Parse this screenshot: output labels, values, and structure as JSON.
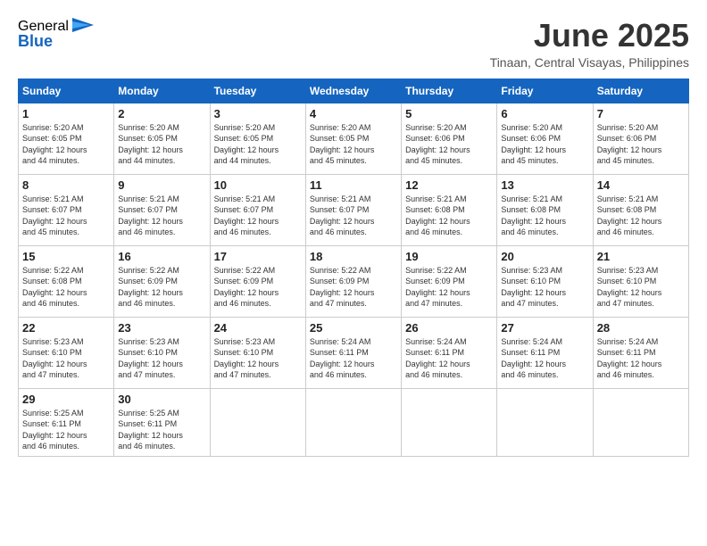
{
  "logo": {
    "general": "General",
    "blue": "Blue"
  },
  "title": "June 2025",
  "location": "Tinaan, Central Visayas, Philippines",
  "days_header": [
    "Sunday",
    "Monday",
    "Tuesday",
    "Wednesday",
    "Thursday",
    "Friday",
    "Saturday"
  ],
  "weeks": [
    [
      {
        "day": "1",
        "info": "Sunrise: 5:20 AM\nSunset: 6:05 PM\nDaylight: 12 hours\nand 44 minutes."
      },
      {
        "day": "2",
        "info": "Sunrise: 5:20 AM\nSunset: 6:05 PM\nDaylight: 12 hours\nand 44 minutes."
      },
      {
        "day": "3",
        "info": "Sunrise: 5:20 AM\nSunset: 6:05 PM\nDaylight: 12 hours\nand 44 minutes."
      },
      {
        "day": "4",
        "info": "Sunrise: 5:20 AM\nSunset: 6:05 PM\nDaylight: 12 hours\nand 45 minutes."
      },
      {
        "day": "5",
        "info": "Sunrise: 5:20 AM\nSunset: 6:06 PM\nDaylight: 12 hours\nand 45 minutes."
      },
      {
        "day": "6",
        "info": "Sunrise: 5:20 AM\nSunset: 6:06 PM\nDaylight: 12 hours\nand 45 minutes."
      },
      {
        "day": "7",
        "info": "Sunrise: 5:20 AM\nSunset: 6:06 PM\nDaylight: 12 hours\nand 45 minutes."
      }
    ],
    [
      {
        "day": "8",
        "info": "Sunrise: 5:21 AM\nSunset: 6:07 PM\nDaylight: 12 hours\nand 45 minutes."
      },
      {
        "day": "9",
        "info": "Sunrise: 5:21 AM\nSunset: 6:07 PM\nDaylight: 12 hours\nand 46 minutes."
      },
      {
        "day": "10",
        "info": "Sunrise: 5:21 AM\nSunset: 6:07 PM\nDaylight: 12 hours\nand 46 minutes."
      },
      {
        "day": "11",
        "info": "Sunrise: 5:21 AM\nSunset: 6:07 PM\nDaylight: 12 hours\nand 46 minutes."
      },
      {
        "day": "12",
        "info": "Sunrise: 5:21 AM\nSunset: 6:08 PM\nDaylight: 12 hours\nand 46 minutes."
      },
      {
        "day": "13",
        "info": "Sunrise: 5:21 AM\nSunset: 6:08 PM\nDaylight: 12 hours\nand 46 minutes."
      },
      {
        "day": "14",
        "info": "Sunrise: 5:21 AM\nSunset: 6:08 PM\nDaylight: 12 hours\nand 46 minutes."
      }
    ],
    [
      {
        "day": "15",
        "info": "Sunrise: 5:22 AM\nSunset: 6:08 PM\nDaylight: 12 hours\nand 46 minutes."
      },
      {
        "day": "16",
        "info": "Sunrise: 5:22 AM\nSunset: 6:09 PM\nDaylight: 12 hours\nand 46 minutes."
      },
      {
        "day": "17",
        "info": "Sunrise: 5:22 AM\nSunset: 6:09 PM\nDaylight: 12 hours\nand 46 minutes."
      },
      {
        "day": "18",
        "info": "Sunrise: 5:22 AM\nSunset: 6:09 PM\nDaylight: 12 hours\nand 47 minutes."
      },
      {
        "day": "19",
        "info": "Sunrise: 5:22 AM\nSunset: 6:09 PM\nDaylight: 12 hours\nand 47 minutes."
      },
      {
        "day": "20",
        "info": "Sunrise: 5:23 AM\nSunset: 6:10 PM\nDaylight: 12 hours\nand 47 minutes."
      },
      {
        "day": "21",
        "info": "Sunrise: 5:23 AM\nSunset: 6:10 PM\nDaylight: 12 hours\nand 47 minutes."
      }
    ],
    [
      {
        "day": "22",
        "info": "Sunrise: 5:23 AM\nSunset: 6:10 PM\nDaylight: 12 hours\nand 47 minutes."
      },
      {
        "day": "23",
        "info": "Sunrise: 5:23 AM\nSunset: 6:10 PM\nDaylight: 12 hours\nand 47 minutes."
      },
      {
        "day": "24",
        "info": "Sunrise: 5:23 AM\nSunset: 6:10 PM\nDaylight: 12 hours\nand 47 minutes."
      },
      {
        "day": "25",
        "info": "Sunrise: 5:24 AM\nSunset: 6:11 PM\nDaylight: 12 hours\nand 46 minutes."
      },
      {
        "day": "26",
        "info": "Sunrise: 5:24 AM\nSunset: 6:11 PM\nDaylight: 12 hours\nand 46 minutes."
      },
      {
        "day": "27",
        "info": "Sunrise: 5:24 AM\nSunset: 6:11 PM\nDaylight: 12 hours\nand 46 minutes."
      },
      {
        "day": "28",
        "info": "Sunrise: 5:24 AM\nSunset: 6:11 PM\nDaylight: 12 hours\nand 46 minutes."
      }
    ],
    [
      {
        "day": "29",
        "info": "Sunrise: 5:25 AM\nSunset: 6:11 PM\nDaylight: 12 hours\nand 46 minutes."
      },
      {
        "day": "30",
        "info": "Sunrise: 5:25 AM\nSunset: 6:11 PM\nDaylight: 12 hours\nand 46 minutes."
      },
      {
        "day": "",
        "info": ""
      },
      {
        "day": "",
        "info": ""
      },
      {
        "day": "",
        "info": ""
      },
      {
        "day": "",
        "info": ""
      },
      {
        "day": "",
        "info": ""
      }
    ]
  ]
}
